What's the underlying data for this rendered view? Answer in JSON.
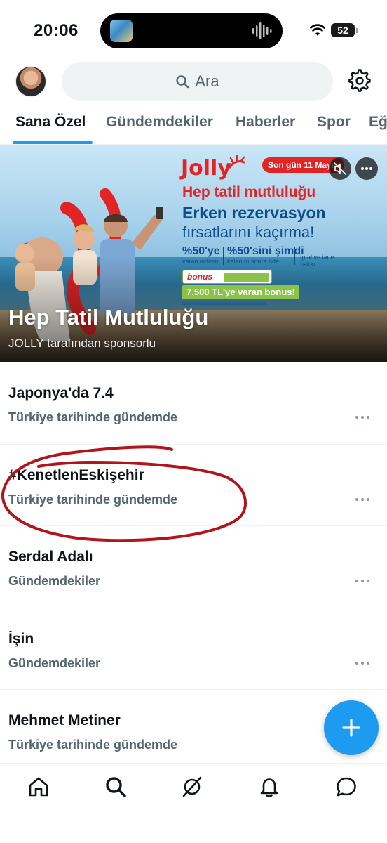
{
  "status_bar": {
    "time": "20:06",
    "battery": "52"
  },
  "header": {
    "search_placeholder": "Ara",
    "icons": [
      "avatar",
      "search-icon",
      "gear-icon"
    ]
  },
  "tabs": [
    {
      "label": "Sana Özel",
      "active": true
    },
    {
      "label": "Gündemdekiler",
      "active": false
    },
    {
      "label": "Haberler",
      "active": false
    },
    {
      "label": "Spor",
      "active": false
    },
    {
      "label": "Eğ",
      "active": false
    }
  ],
  "ad": {
    "brand": "Jolly",
    "ribbon": "Son gün 11 Mayıs",
    "headline": "Hep tatil mutluluğu",
    "line2": "Erken rezervasyon",
    "line3": "fırsatlarını kaçırma!",
    "offer1_big": "%50'ye",
    "offer1_small": "varan indirim",
    "offer2_big": "%50'sini şimdi",
    "offer2_small": "kalanını sonra öde",
    "offer3_small": "İptal ve iade hakkı",
    "bonus_logo": "bonus",
    "bonus_bar": "7.500 TL'ye varan bonus!",
    "title": "Hep Tatil Mutluluğu",
    "sponsor": "JOLLY tarafından sponsorlu"
  },
  "trends": [
    {
      "title": "Japonya'da 7.4",
      "context": "Türkiye tarihinde gündemde"
    },
    {
      "title": "#KenetlenEskişehir",
      "context": "Türkiye tarihinde gündemde"
    },
    {
      "title": "Serdal Adalı",
      "context": "Gündemdekiler"
    },
    {
      "title": "İşin",
      "context": "Gündemdekiler"
    },
    {
      "title": "Mehmet Metiner",
      "context": "Türkiye tarihinde gündemde"
    }
  ],
  "colors": {
    "accent": "#1d9bf0",
    "text_primary": "#0f1419",
    "text_secondary": "#536471",
    "annotation": "#b0151b",
    "jolly_red": "#e42325"
  },
  "bottom_nav": [
    "home-icon",
    "search-icon",
    "grok-icon",
    "bell-icon",
    "message-icon"
  ]
}
